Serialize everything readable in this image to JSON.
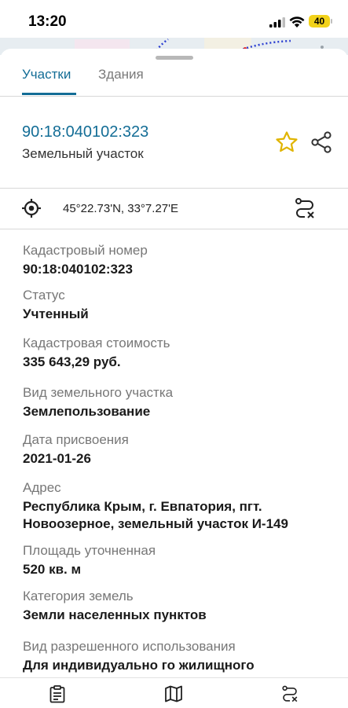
{
  "status_bar": {
    "time": "13:20",
    "battery": "40"
  },
  "tabs": [
    {
      "label": "Участки",
      "active": true
    },
    {
      "label": "Здания",
      "active": false
    }
  ],
  "parcel": {
    "cadastral_link": "90:18:040102:323",
    "type": "Земельный участок",
    "coordinates": "45°22.73'N, 33°7.27'E"
  },
  "fields": [
    {
      "label": "Кадастровый номер",
      "value": "90:18:040102:323"
    },
    {
      "label": "Статус",
      "value": "Учтенный"
    },
    {
      "label": "Кадастровая стоимость",
      "value": "335 643,29 руб."
    },
    {
      "label": "Вид земельного участка",
      "value": "Землепользование"
    },
    {
      "label": "Дата присвоения",
      "value": "2021-01-26"
    },
    {
      "label": "Адрес",
      "value_line1": "Республика Крым, г. Евпатория, пгт.",
      "value_line2": "Новоозерное, земельный участок И-149"
    },
    {
      "label": "Площадь уточненная",
      "value": "520 кв. м"
    },
    {
      "label": "Категория земель",
      "value": "Земли населенных пунктов"
    },
    {
      "label": "Вид разрешенного использования",
      "value": "Для индивидуально го жилищного"
    }
  ],
  "icons": {
    "favorite": "star-icon",
    "share": "share-icon",
    "locate": "locate-icon",
    "route": "route-clear-icon",
    "nav_list": "clipboard-icon",
    "nav_map": "map-icon",
    "nav_route": "route-clear-icon"
  },
  "colors": {
    "accent": "#136d96",
    "star": "#e0b400",
    "battery": "#f2d21a"
  }
}
